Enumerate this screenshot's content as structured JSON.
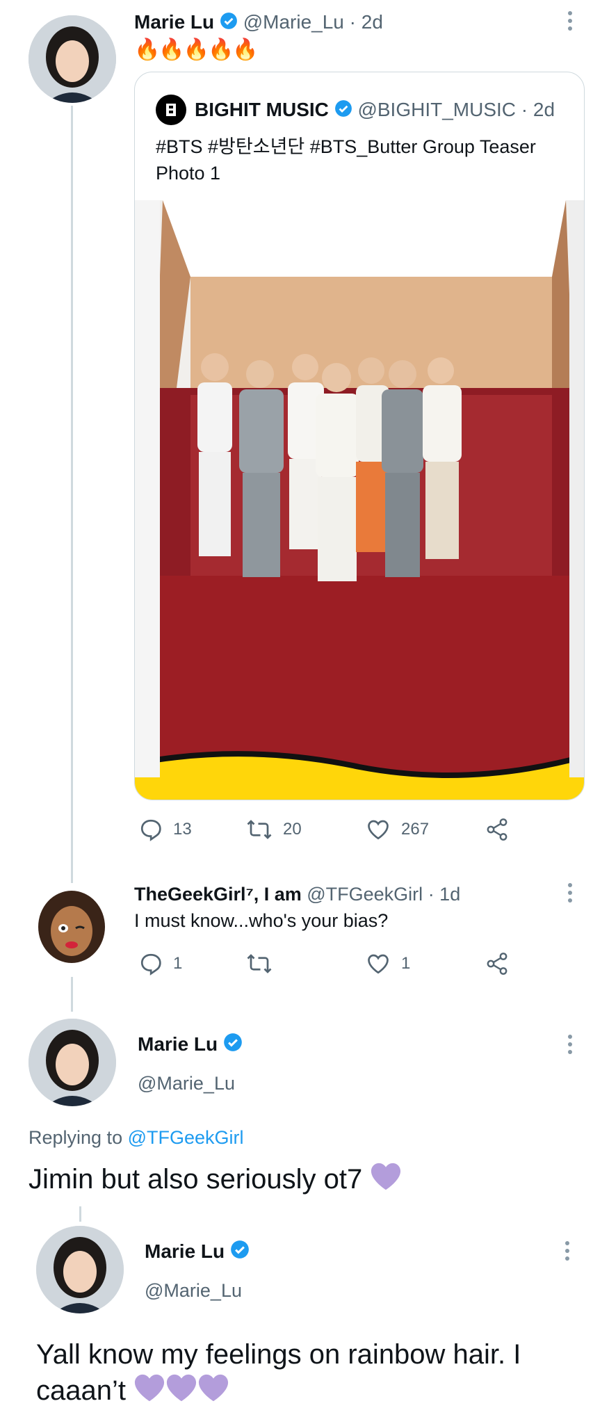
{
  "tweet1": {
    "name": "Marie Lu",
    "handle": "@Marie_Lu",
    "time": "· 2d",
    "emojis": "🔥🔥🔥🔥🔥"
  },
  "quote": {
    "name": "BIGHIT MUSIC",
    "handle": "@BIGHIT_MUSIC",
    "time": "· 2d",
    "text": "#BTS #방탄소년단 #BTS_Butter Group Teaser Photo 1",
    "image_alt": "group-photo"
  },
  "tweet1_actions": {
    "replies": "13",
    "retweets": "20",
    "likes": "267"
  },
  "tweet2": {
    "name": "TheGeekGirl⁷, I am",
    "handle": "@TFGeekGirl",
    "time": "· 1d",
    "text": "I must know...who's your bias?",
    "replies": "1",
    "likes": "1"
  },
  "tweet3": {
    "name": "Marie Lu",
    "handle": "@Marie_Lu",
    "replying_prefix": "Replying to",
    "replying_handle": "@TFGeekGirl",
    "text": "Jimin but also seriously ot7"
  },
  "tweet4": {
    "name": "Marie Lu",
    "handle": "@Marie_Lu",
    "text_line1": "Yall know my feelings on rainbow hair. I",
    "text_line2": "caaan’t"
  },
  "colors": {
    "verified": "#1d9bf0",
    "link": "#1d9bf0",
    "heart_purple": "#b39ddb",
    "icon_gray": "#536471"
  }
}
